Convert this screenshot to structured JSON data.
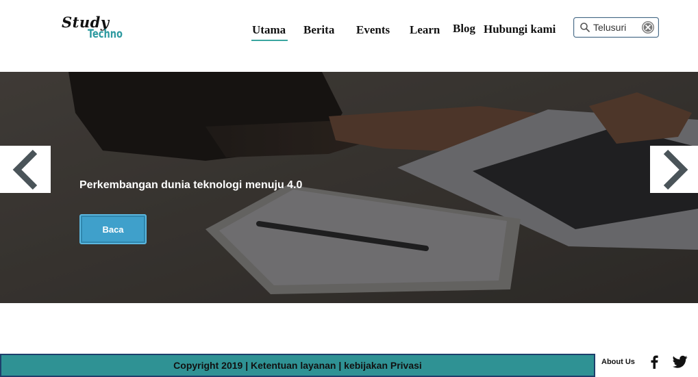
{
  "brand": {
    "line1": "Study",
    "line2": "Techno",
    "accent": "#2e9aa0"
  },
  "nav": {
    "items": [
      {
        "label": "Utama",
        "active": true
      },
      {
        "label": "Berita"
      },
      {
        "label": "Events"
      },
      {
        "label": "Learn"
      },
      {
        "label": "Blog"
      },
      {
        "label": "Hubungi kami"
      }
    ]
  },
  "search": {
    "value": "",
    "placeholder": "Telusuri",
    "icon": "search-icon",
    "clear_icon": "close-circle-icon"
  },
  "hero": {
    "caption": "Perkembangan dunia teknologi menuju 4.0",
    "button_label": "Baca",
    "button_color": "#3fa0cb",
    "prev_icon": "chevron-left-icon",
    "next_icon": "chevron-right-icon"
  },
  "footer": {
    "copyright": "Copyright 2019 | Ketentuan layanan | kebijakan Privasi",
    "about": "About Us",
    "bar_color": "#2f9294",
    "social": [
      "facebook-icon",
      "twitter-icon"
    ]
  }
}
